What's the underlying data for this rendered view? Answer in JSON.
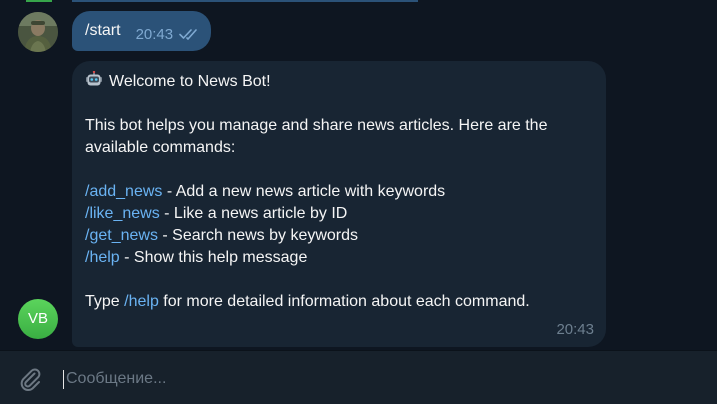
{
  "colors": {
    "background": "#0e1621",
    "outgoing_bubble": "#2b5278",
    "incoming_bubble": "#182533",
    "link": "#6ab3f3",
    "composer": "#17212b",
    "bot_avatar": "#4cc24f"
  },
  "messages": {
    "outgoing": {
      "text": "/start",
      "time": "20:43",
      "status_icon": "double-check-icon"
    },
    "incoming": {
      "avatar_initials": "VB",
      "robot_icon": "robot-icon",
      "title": "Welcome to News Bot!",
      "intro": "This bot helps you manage and share news articles. Here are the available commands:",
      "commands": [
        {
          "command": "/add_news",
          "description": " - Add a new news article with keywords"
        },
        {
          "command": "/like_news",
          "description": " - Like a news article by ID"
        },
        {
          "command": "/get_news",
          "description": " - Search news by keywords"
        },
        {
          "command": "/help",
          "description": " - Show this help message"
        }
      ],
      "footer_prefix": "Type ",
      "footer_command": "/help",
      "footer_suffix": " for more detailed information about each command.",
      "time": "20:43"
    }
  },
  "composer": {
    "placeholder": "Сообщение...",
    "value": "",
    "attach_icon": "paperclip-icon"
  }
}
